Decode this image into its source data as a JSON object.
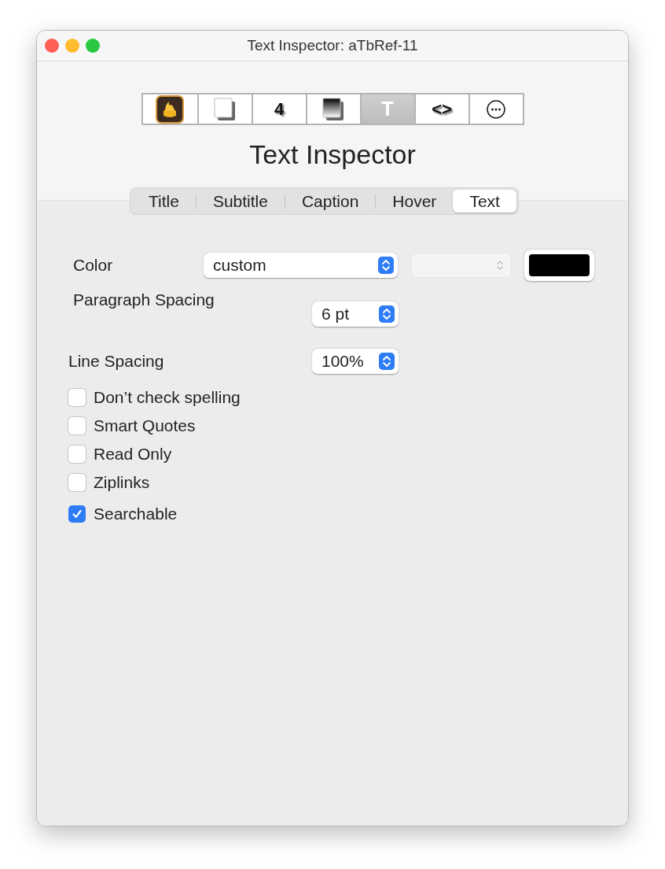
{
  "window": {
    "title": "Text Inspector: aTbRef-11"
  },
  "toolbar": [
    {
      "kind": "flame",
      "selected": false
    },
    {
      "kind": "page",
      "selected": false
    },
    {
      "kind": "glyph",
      "glyph": "4",
      "selected": false
    },
    {
      "kind": "gradient",
      "selected": false
    },
    {
      "kind": "glyph",
      "glyph": "T",
      "selected": true
    },
    {
      "kind": "glyph",
      "glyph": "<>",
      "selected": false
    },
    {
      "kind": "more",
      "selected": false
    }
  ],
  "heading": "Text Inspector",
  "tabs": [
    {
      "label": "Title",
      "selected": false
    },
    {
      "label": "Subtitle",
      "selected": false
    },
    {
      "label": "Caption",
      "selected": false
    },
    {
      "label": "Hover",
      "selected": false
    },
    {
      "label": "Text",
      "selected": true
    }
  ],
  "color_row": {
    "label": "Color",
    "popup": "custom",
    "second_popup_disabled": true,
    "color": "#000000"
  },
  "paragraph_spacing": {
    "label": "Paragraph Spacing",
    "popup": "6 pt"
  },
  "line_spacing": {
    "label": "Line Spacing",
    "popup": "100%"
  },
  "checkboxes": [
    {
      "label": "Don’t check spelling",
      "checked": false
    },
    {
      "label": "Smart Quotes",
      "checked": false
    },
    {
      "label": "Read Only",
      "checked": false
    },
    {
      "label": "Ziplinks",
      "checked": false
    },
    {
      "label": "Searchable",
      "checked": true
    }
  ]
}
